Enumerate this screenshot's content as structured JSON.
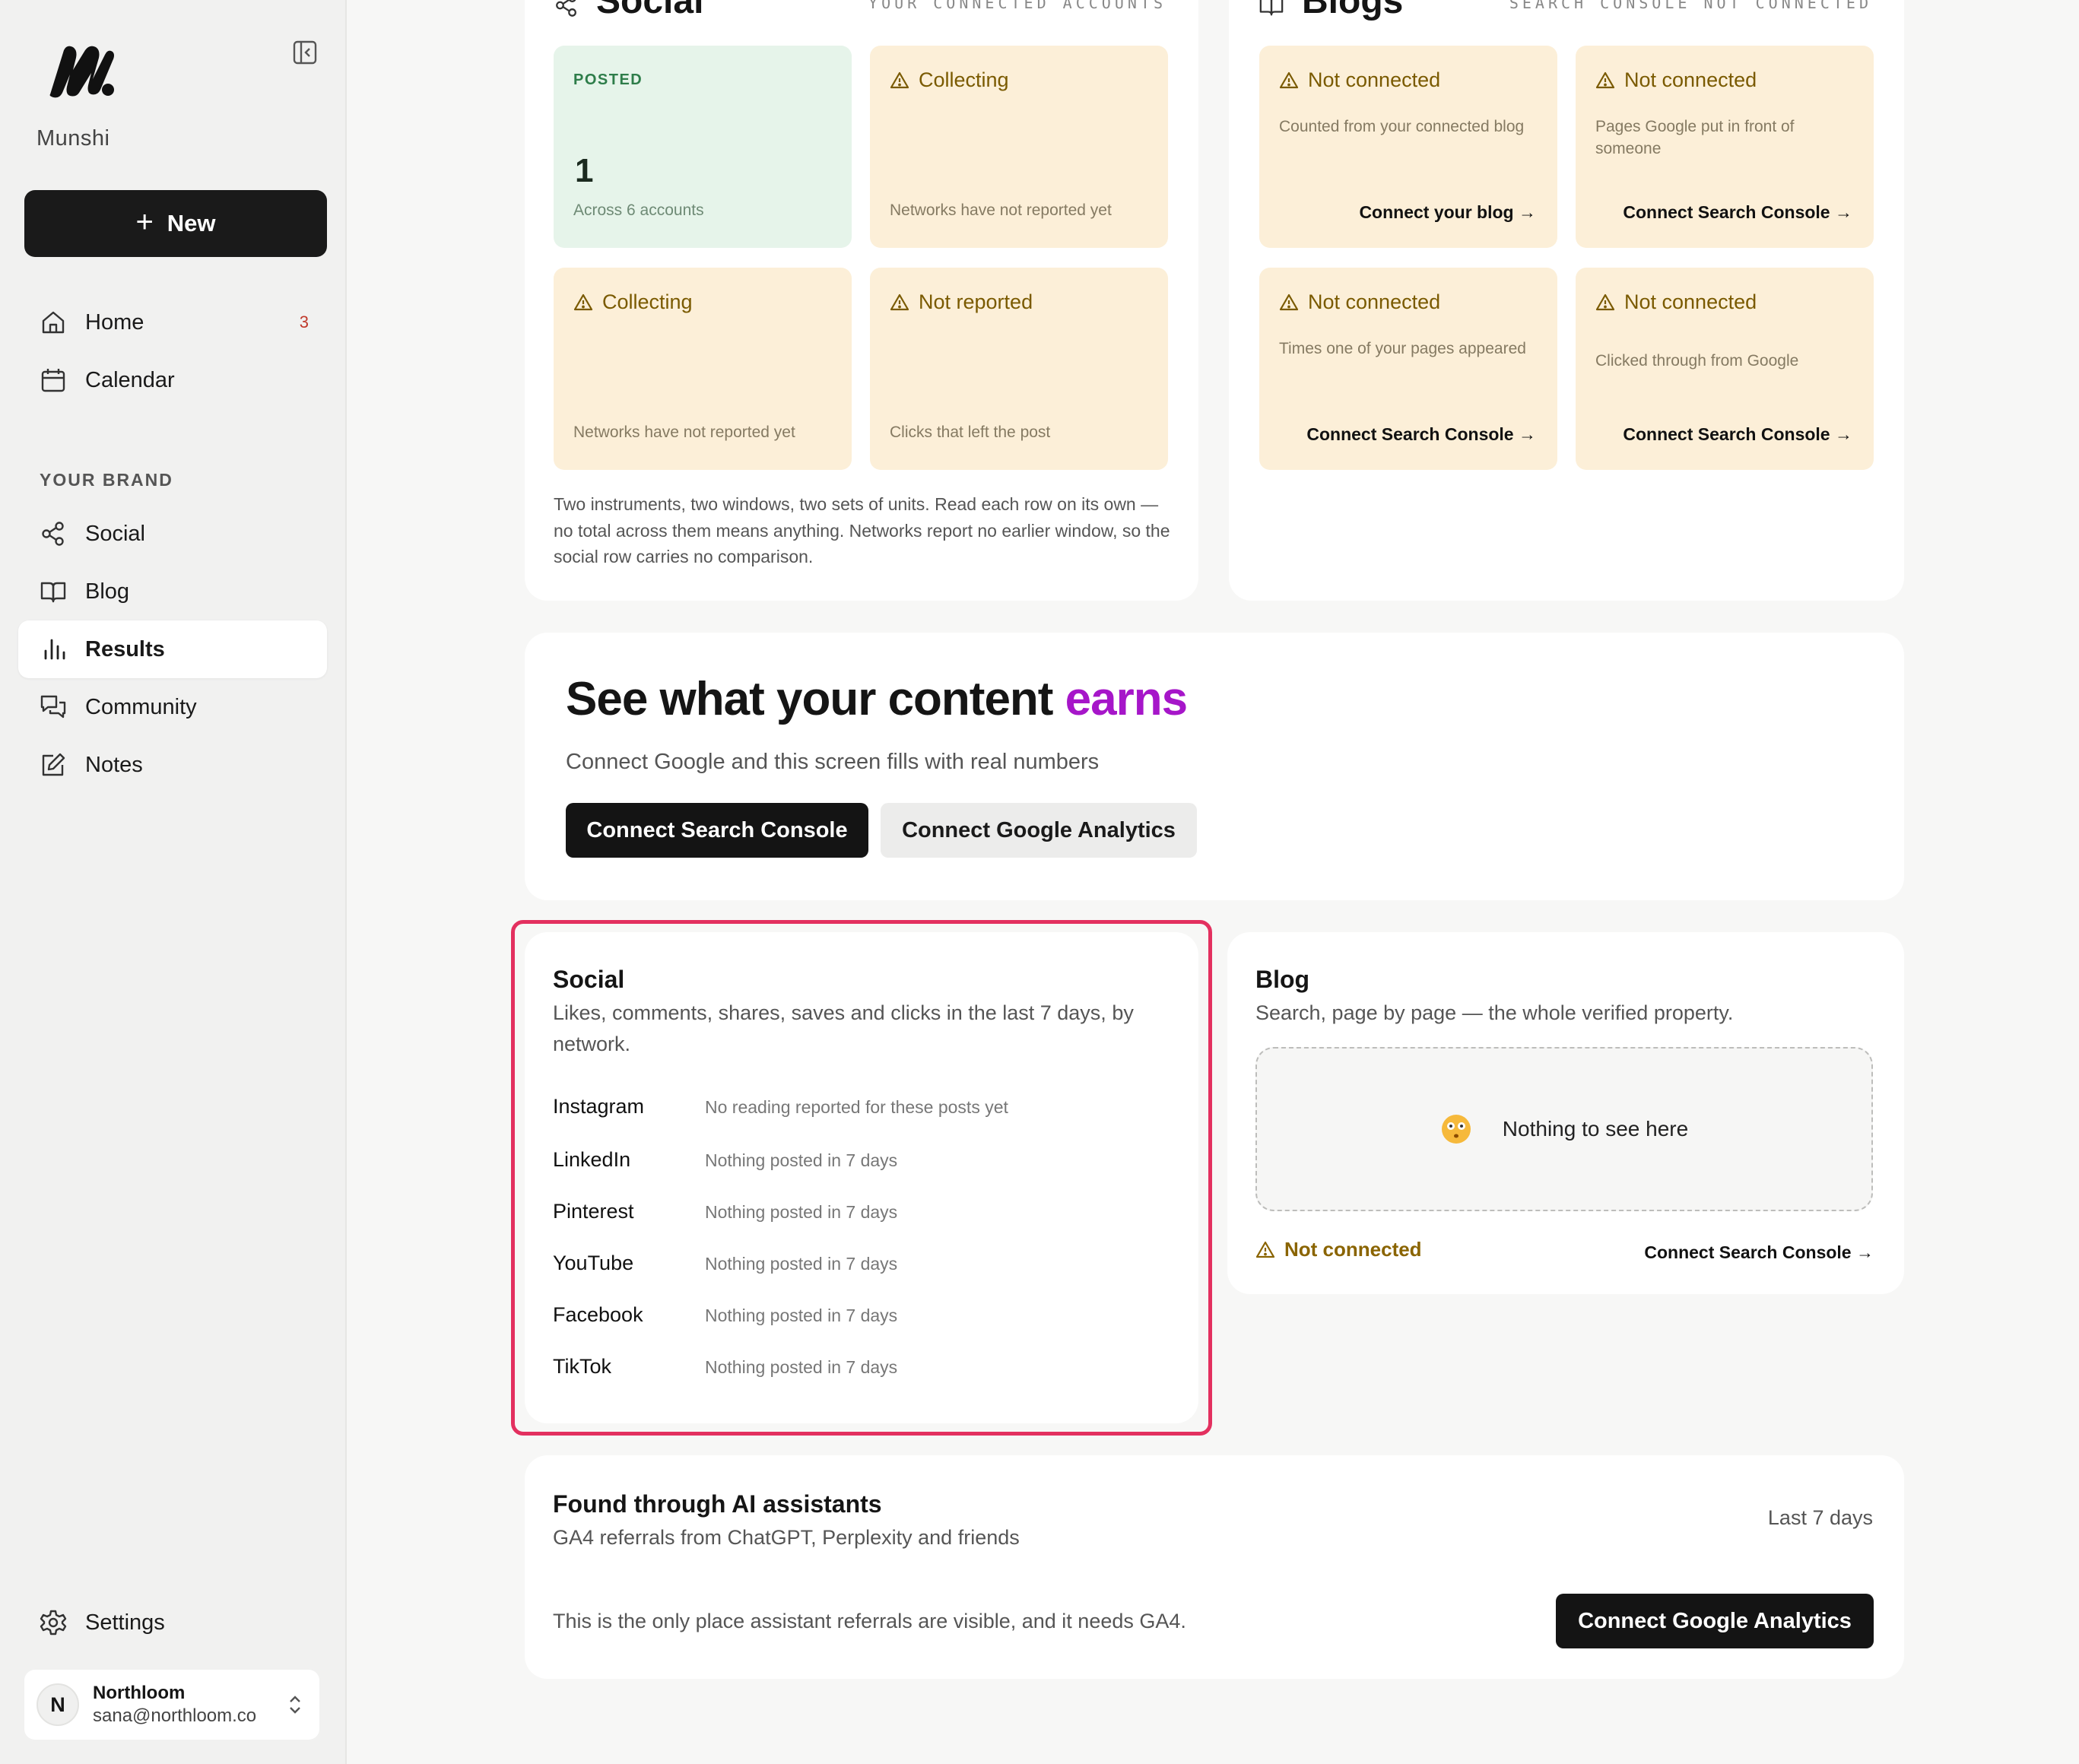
{
  "sidebar": {
    "brand": "Munshi",
    "new_label": "New",
    "nav": [
      {
        "label": "Home",
        "badge": "3"
      },
      {
        "label": "Calendar"
      }
    ],
    "section_label": "YOUR BRAND",
    "brand_nav": [
      {
        "label": "Social"
      },
      {
        "label": "Blog"
      },
      {
        "label": "Results",
        "active": true
      },
      {
        "label": "Community"
      },
      {
        "label": "Notes"
      }
    ],
    "settings_label": "Settings",
    "account": {
      "initial": "N",
      "name": "Northloom",
      "email": "sana@northloom.co"
    }
  },
  "social_panel": {
    "title": "Social",
    "meta": "YOUR CONNECTED ACCOUNTS",
    "tiles": [
      {
        "kind": "posted",
        "label": "POSTED",
        "value": "1",
        "desc": "Across 6 accounts"
      },
      {
        "kind": "warn",
        "label": "Collecting",
        "desc": "Networks have not reported yet"
      },
      {
        "kind": "warn",
        "label": "Collecting",
        "desc": "Networks have not reported yet"
      },
      {
        "kind": "warn",
        "label": "Not reported",
        "desc": "Clicks that left the post"
      }
    ],
    "note": "Two instruments, two windows, two sets of units. Read each row on its own — no total across them means anything. Networks report no earlier window, so the social row carries no comparison."
  },
  "blogs_panel": {
    "title": "Blogs",
    "meta": "SEARCH CONSOLE NOT CONNECTED",
    "tiles": [
      {
        "label": "Not connected",
        "desc": "Counted from your connected blog",
        "link": "Connect your blog →"
      },
      {
        "label": "Not connected",
        "desc": "Pages Google put in front of someone",
        "link": "Connect Search Console →"
      },
      {
        "label": "Not connected",
        "desc": "Times one of your pages appeared",
        "link": "Connect Search Console →"
      },
      {
        "label": "Not connected",
        "desc": "Clicked through from Google",
        "link": "Connect Search Console →"
      }
    ]
  },
  "hero": {
    "title_main": "See what your content ",
    "title_accent": "earns",
    "subtitle": "Connect Google and this screen fills with real numbers",
    "primary_btn": "Connect Search Console",
    "secondary_btn": "Connect Google Analytics"
  },
  "social_section": {
    "title": "Social",
    "subtitle": "Likes, comments, shares, saves and clicks in the last 7 days, by network.",
    "networks": [
      {
        "name": "Instagram",
        "status": "No reading reported for these posts yet"
      },
      {
        "name": "LinkedIn",
        "status": "Nothing posted in 7 days"
      },
      {
        "name": "Pinterest",
        "status": "Nothing posted in 7 days"
      },
      {
        "name": "YouTube",
        "status": "Nothing posted in 7 days"
      },
      {
        "name": "Facebook",
        "status": "Nothing posted in 7 days"
      },
      {
        "name": "TikTok",
        "status": "Nothing posted in 7 days"
      }
    ]
  },
  "blog_section": {
    "title": "Blog",
    "subtitle": "Search, page by page — the whole verified property.",
    "empty_text": "Nothing to see here",
    "status": "Not connected",
    "link": "Connect Search Console →"
  },
  "ai_section": {
    "title": "Found through AI assistants",
    "subtitle": "GA4 referrals from ChatGPT, Perplexity and friends",
    "range": "Last 7 days",
    "body": "This is the only place assistant referrals are visible, and it needs GA4.",
    "button": "Connect Google Analytics"
  },
  "colors": {
    "accent": "#a616c9",
    "highlight": "#e3305f",
    "warn_tile": "#fcefd8",
    "posted_tile": "#e6f4ea"
  }
}
